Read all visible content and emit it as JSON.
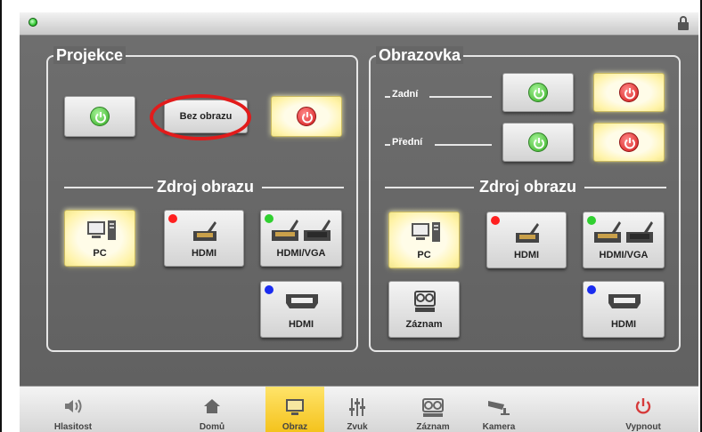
{
  "window": {
    "status_led_color": "#32c832",
    "lock_icon": "lock-icon"
  },
  "projekce": {
    "title": "Projekce",
    "power_on_icon": "power-icon",
    "no_image_label": "Bez obrazu",
    "power_off_icon": "power-icon",
    "source_title": "Zdroj obrazu",
    "sources": [
      {
        "label": "PC",
        "icon": "computer-icon",
        "active": true
      },
      {
        "label": "HDMI",
        "icon": "hdmi-cable-icon",
        "dot": "#ff2020"
      },
      {
        "label": "HDMI/VGA",
        "icon": "hdmi-vga-cable-icon",
        "dot": "#30d030"
      },
      {
        "label": "HDMI",
        "icon": "hdmi-port-icon",
        "dot": "#1a2cf0"
      }
    ]
  },
  "obrazovka": {
    "title": "Obrazovka",
    "rows": [
      {
        "label": "Zadní"
      },
      {
        "label": "Přední"
      }
    ],
    "source_title": "Zdroj obrazu",
    "sources": [
      {
        "label": "PC",
        "icon": "computer-icon",
        "active": true
      },
      {
        "label": "HDMI",
        "icon": "hdmi-cable-icon",
        "dot": "#ff2020"
      },
      {
        "label": "HDMI/VGA",
        "icon": "hdmi-vga-cable-icon",
        "dot": "#30d030"
      },
      {
        "label": "Záznam",
        "icon": "recorder-icon"
      },
      {
        "label": "HDMI",
        "icon": "hdmi-port-icon",
        "dot": "#1a2cf0"
      }
    ]
  },
  "annotation": {
    "color": "#e21b1b"
  },
  "bottom_nav": [
    {
      "label": "Hlasitost",
      "icon": "speaker-icon"
    },
    {
      "label": "Domů",
      "icon": "home-icon"
    },
    {
      "label": "Obraz",
      "icon": "display-icon",
      "active": true
    },
    {
      "label": "Zvuk",
      "icon": "mixer-icon"
    },
    {
      "label": "Záznam",
      "icon": "recorder-icon"
    },
    {
      "label": "Kamera",
      "icon": "camera-icon"
    },
    {
      "label": "Vypnout",
      "icon": "power-icon"
    }
  ],
  "colors": {
    "active_yellow": "#fff3a8",
    "power_green": "#55c244",
    "power_red": "#e23a3a",
    "nav_active": "#f4c21b"
  }
}
